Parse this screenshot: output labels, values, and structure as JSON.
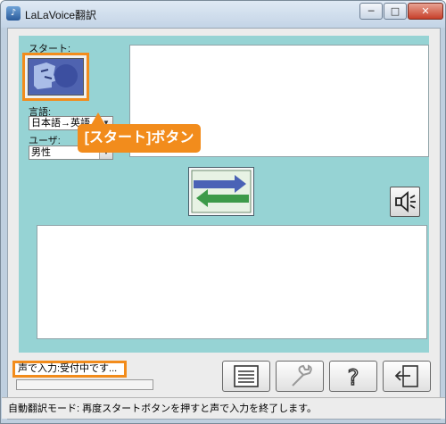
{
  "window": {
    "title": "LaLaVoice翻訳",
    "minimize_label": "─",
    "maximize_label": "□",
    "close_label": "✕"
  },
  "start": {
    "label": "スタート:",
    "icon": "face-profile-icon"
  },
  "language": {
    "label": "言語:",
    "selected": "日本語→英語"
  },
  "user": {
    "label": "ユーザ:",
    "selected": "男性"
  },
  "callout": {
    "text": "[スタート]ボタン"
  },
  "status": {
    "text": "声で入力:受付中です...",
    "progress": 0
  },
  "icons": {
    "swap": "swap-arrows-icon",
    "speaker": "speaker-icon",
    "list": "list-icon",
    "wrench": "wrench-icon",
    "help": "help-icon",
    "exit": "exit-icon"
  },
  "bottom": {
    "mode_text": "自動翻訳モード: 再度スタートボタンを押すと声で入力を終了します。"
  },
  "colors": {
    "panel": "#96d3d4",
    "highlight": "#f28c1c",
    "accent_green": "#3c9a49",
    "accent_blue": "#4a62b6"
  }
}
